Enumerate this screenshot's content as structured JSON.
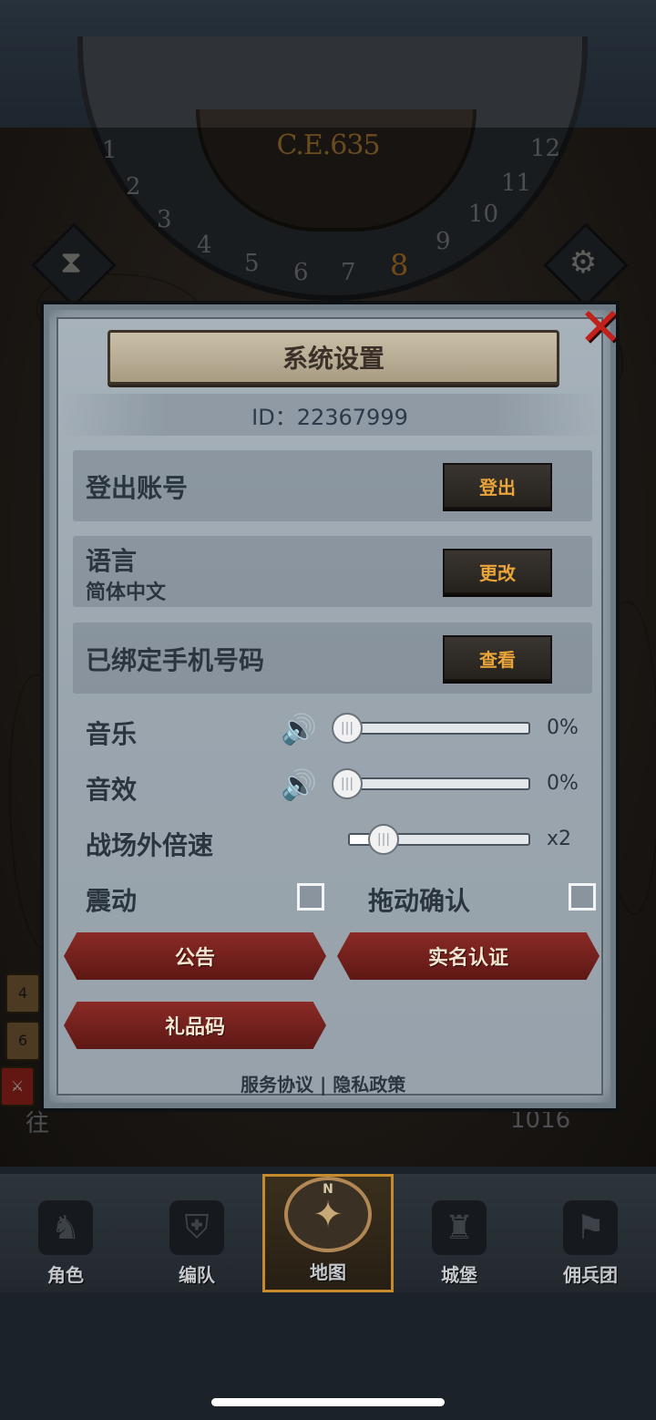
{
  "map": {
    "era": "C.E.635",
    "dial_numbers": [
      "1",
      "2",
      "3",
      "4",
      "5",
      "6",
      "7",
      "8",
      "9",
      "10",
      "11",
      "12"
    ],
    "active_number": "8",
    "bottom_text_left": "往",
    "bottom_count": "1016"
  },
  "dialog": {
    "title": "系统设置",
    "id_text": "ID：22367999",
    "logout": {
      "label": "登出账号",
      "button": "登出"
    },
    "language": {
      "label": "语言",
      "value": "简体中文",
      "button": "更改"
    },
    "phone": {
      "label": "已绑定手机号码",
      "button": "查看"
    },
    "music": {
      "label": "音乐",
      "value_text": "0%",
      "value": 0
    },
    "sfx": {
      "label": "音效",
      "value_text": "0%",
      "value": 0
    },
    "speed": {
      "label": "战场外倍速",
      "value_text": "x2"
    },
    "vibration": {
      "label": "震动",
      "checked": false
    },
    "drag_confirm": {
      "label": "拖动确认",
      "checked": false
    },
    "buttons": {
      "announcement": "公告",
      "real_name": "实名认证",
      "gift_code": "礼品码"
    },
    "links": {
      "terms": "服务协议",
      "separator": "|",
      "privacy": "隐私政策"
    }
  },
  "nav": {
    "tabs": [
      {
        "label": "角色",
        "icon": "knight-icon"
      },
      {
        "label": "编队",
        "icon": "helmet-icon"
      },
      {
        "label": "地图",
        "icon": "compass-map-icon",
        "active": true,
        "compass_letter": "N"
      },
      {
        "label": "城堡",
        "icon": "castle-icon"
      },
      {
        "label": "佣兵团",
        "icon": "banner-icon"
      }
    ]
  },
  "side_icons": {
    "scroll_count_1": "4",
    "scroll_count_2": "6"
  },
  "colors": {
    "accent_gold": "#e9a43a",
    "ribbon_red": "#7a2420",
    "close_red": "#c4201a"
  }
}
